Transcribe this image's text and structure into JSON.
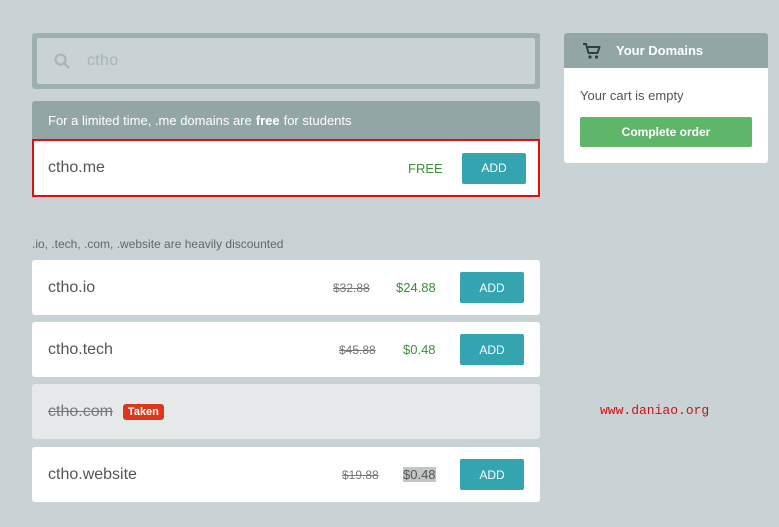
{
  "search": {
    "query": "ctho"
  },
  "promo": {
    "text_before": "For a limited time, .me domains are",
    "text_bold": "free",
    "text_after": "for students",
    "domain": "ctho.me",
    "price_label": "FREE",
    "button_label": "ADD"
  },
  "discount_note": ".io, .tech, .com, .website are heavily discounted",
  "domains": [
    {
      "name": "ctho.io",
      "old_price": "$32.88",
      "new_price": "$24.88",
      "button_label": "ADD"
    },
    {
      "name": "ctho.tech",
      "old_price": "$45.88",
      "new_price": "$0.48",
      "button_label": "ADD"
    },
    {
      "name": "ctho.com",
      "status": "Taken"
    },
    {
      "name": "ctho.website",
      "old_price": "$19.88",
      "new_price": "$0.48",
      "button_label": "ADD"
    }
  ],
  "sidebar": {
    "title": "Your Domains",
    "cart_text": "Your cart is empty",
    "complete_label": "Complete order"
  },
  "watermark": "www.daniao.org",
  "colors": {
    "accent": "#34a4b0",
    "success": "#5fb66b",
    "taken": "#d9391a",
    "highlight_border": "#e01010"
  },
  "icons": {
    "search": "search-icon",
    "cart": "cart-icon"
  }
}
